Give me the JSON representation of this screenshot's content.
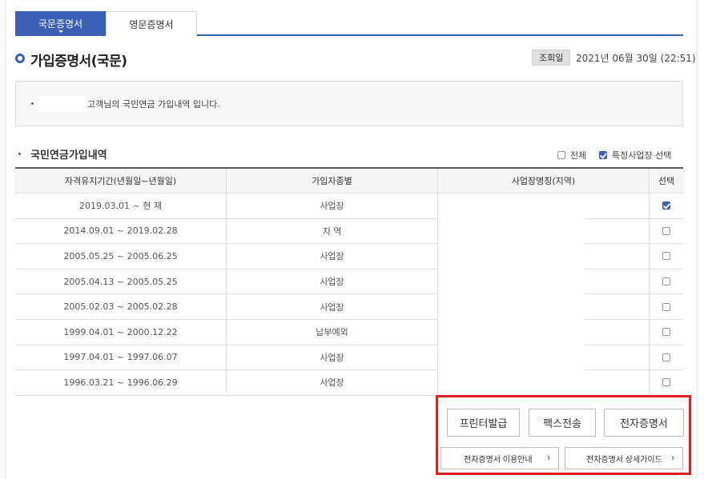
{
  "tabs": [
    {
      "label": "국문증명서",
      "active": true
    },
    {
      "label": "영문증명서",
      "active": false
    }
  ],
  "page_title": "가입증명서(국문)",
  "lookup": {
    "label": "조회일",
    "date": "2021년 06월 30일 (22:51)"
  },
  "notice": {
    "message": "고객님의 국민연금 가입내역 입니다."
  },
  "section": {
    "title": "국민연금가입내역",
    "option_all": {
      "label": "전체",
      "checked": false
    },
    "option_specific": {
      "label": "특정사업장 선택",
      "checked": true
    }
  },
  "table": {
    "headers": [
      "자격유지기간(년월일~년월일)",
      "가입자종별",
      "사업장명칭(지역)",
      "선택"
    ],
    "rows": [
      {
        "period": "2019.03.01 ~ 현 재",
        "type": "사업장",
        "workplace": "",
        "selected": true
      },
      {
        "period": "2014.09.01 ~ 2019.02.28",
        "type": "지 역",
        "workplace": "",
        "selected": false
      },
      {
        "period": "2005.05.25 ~ 2005.06.25",
        "type": "사업장",
        "workplace": "",
        "selected": false
      },
      {
        "period": "2005.04.13 ~ 2005.05.25",
        "type": "사업장",
        "workplace": "",
        "selected": false
      },
      {
        "period": "2005.02.03 ~ 2005.02.28",
        "type": "사업장",
        "workplace": "",
        "selected": false
      },
      {
        "period": "1999.04.01 ~ 2000.12.22",
        "type": "납부예외",
        "workplace": "",
        "selected": false
      },
      {
        "period": "1997.04.01 ~ 1997.06.07",
        "type": "사업장",
        "workplace": "",
        "selected": false
      },
      {
        "period": "1996.03.21 ~ 1996.06.29",
        "type": "사업장",
        "workplace": "",
        "selected": false
      }
    ]
  },
  "buttons": {
    "print": "프린터발급",
    "fax": "팩스전송",
    "ecert": "전자증명서",
    "guide": "전자증명서 이용안내",
    "detail_guide": "전자증명서 상세가이드",
    "chevron": "›"
  },
  "colors": {
    "accent": "#3a5fb4",
    "highlight_border": "#e02020"
  }
}
